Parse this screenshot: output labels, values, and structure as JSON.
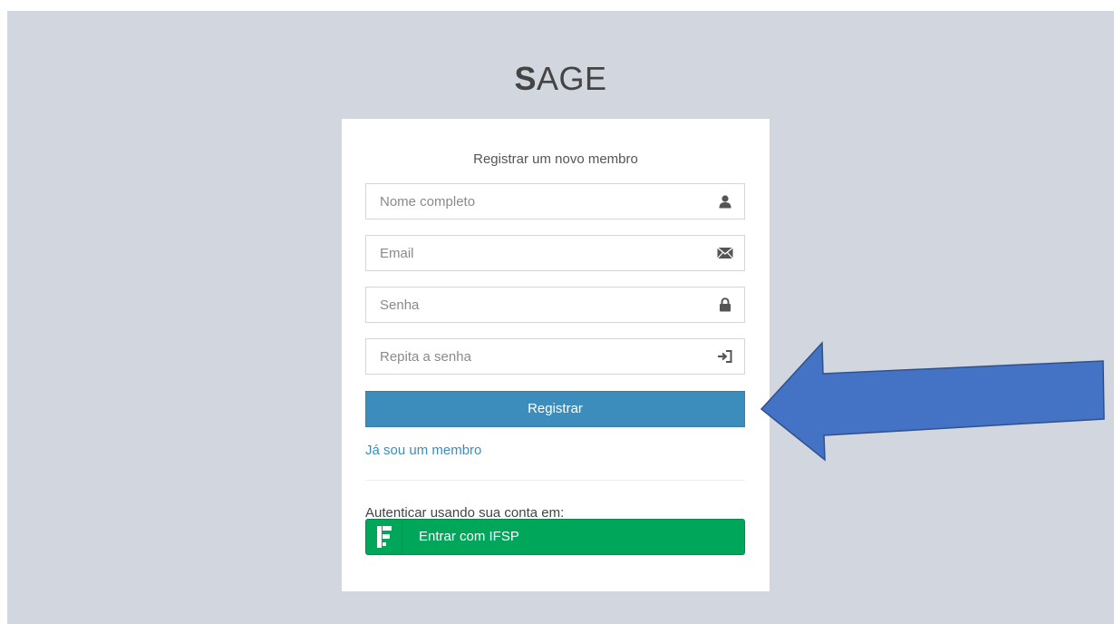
{
  "logo": {
    "bold": "S",
    "rest": "AGE"
  },
  "card": {
    "title": "Registrar um novo membro",
    "fields": [
      {
        "placeholder": "Nome completo",
        "icon": "user-icon"
      },
      {
        "placeholder": "Email",
        "icon": "envelope-icon"
      },
      {
        "placeholder": "Senha",
        "icon": "lock-icon"
      },
      {
        "placeholder": "Repita a senha",
        "icon": "log-in-icon"
      }
    ],
    "register_button": "Registrar",
    "member_link": "Já sou um membro",
    "auth_label": "Autenticar usando sua conta em:",
    "ifsp_button": "Entrar com IFSP"
  },
  "colors": {
    "background": "#d2d6de",
    "primary": "#3c8dbc",
    "success": "#00a65a",
    "annotation_arrow": "#4472c4"
  }
}
